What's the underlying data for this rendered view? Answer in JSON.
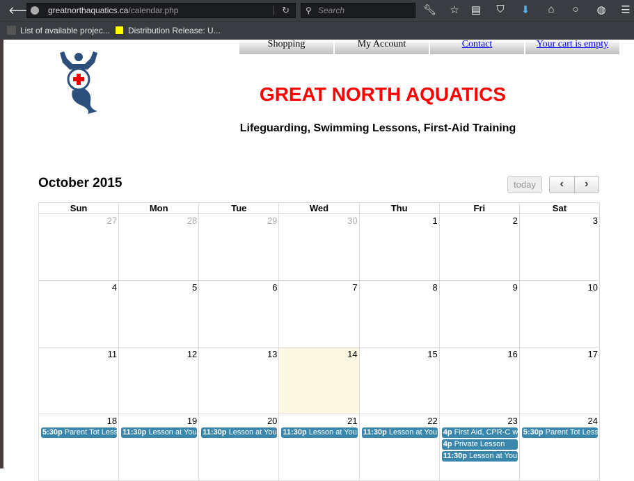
{
  "browser": {
    "url_domain": "greatnorthaquatics.ca",
    "url_path": "/calendar.php",
    "search_placeholder": "Search",
    "bookmarks": [
      {
        "label": "List of available projec..."
      },
      {
        "label": "Distribution Release: U..."
      }
    ]
  },
  "nav": [
    {
      "label": "Shopping"
    },
    {
      "label": "My Account"
    },
    {
      "label": "Contact"
    },
    {
      "label": "Your cart is empty"
    }
  ],
  "site": {
    "title": "GREAT NORTH AQUATICS",
    "subtitle": "Lifeguarding, Swimming Lessons, First-Aid Training"
  },
  "calendar": {
    "month": "October 2015",
    "today_label": "today",
    "prev": "‹",
    "next": "›",
    "days": [
      "Sun",
      "Mon",
      "Tue",
      "Wed",
      "Thu",
      "Fri",
      "Sat"
    ],
    "weeks": [
      [
        {
          "d": "27",
          "o": 1
        },
        {
          "d": "28",
          "o": 1
        },
        {
          "d": "29",
          "o": 1
        },
        {
          "d": "30",
          "o": 1
        },
        {
          "d": "1"
        },
        {
          "d": "2"
        },
        {
          "d": "3"
        }
      ],
      [
        {
          "d": "4"
        },
        {
          "d": "5"
        },
        {
          "d": "6"
        },
        {
          "d": "7"
        },
        {
          "d": "8"
        },
        {
          "d": "9"
        },
        {
          "d": "10"
        }
      ],
      [
        {
          "d": "11"
        },
        {
          "d": "12"
        },
        {
          "d": "13"
        },
        {
          "d": "14",
          "t": 1
        },
        {
          "d": "15"
        },
        {
          "d": "16"
        },
        {
          "d": "17"
        }
      ],
      [
        {
          "d": "18",
          "ev": [
            {
              "time": "5:30p",
              "title": "Parent Tot Less"
            }
          ]
        },
        {
          "d": "19",
          "ev": [
            {
              "time": "11:30p",
              "title": "Lesson at You"
            }
          ]
        },
        {
          "d": "20",
          "ev": [
            {
              "time": "11:30p",
              "title": "Lesson at You"
            }
          ]
        },
        {
          "d": "21",
          "ev": [
            {
              "time": "11:30p",
              "title": "Lesson at You"
            }
          ]
        },
        {
          "d": "22",
          "ev": [
            {
              "time": "11:30p",
              "title": "Lesson at You"
            }
          ]
        },
        {
          "d": "23",
          "ev": [
            {
              "time": "4p",
              "title": "First Aid, CPR-C w"
            },
            {
              "time": "4p",
              "title": "Private Lesson"
            },
            {
              "time": "11:30p",
              "title": "Lesson at You"
            }
          ]
        },
        {
          "d": "24",
          "ev": [
            {
              "time": "5:30p",
              "title": "Parent Tot Less"
            }
          ]
        }
      ]
    ]
  },
  "colors": {
    "event": "#3a87ad",
    "title": "#ff0000",
    "today_bg": "#fcf8e3"
  }
}
